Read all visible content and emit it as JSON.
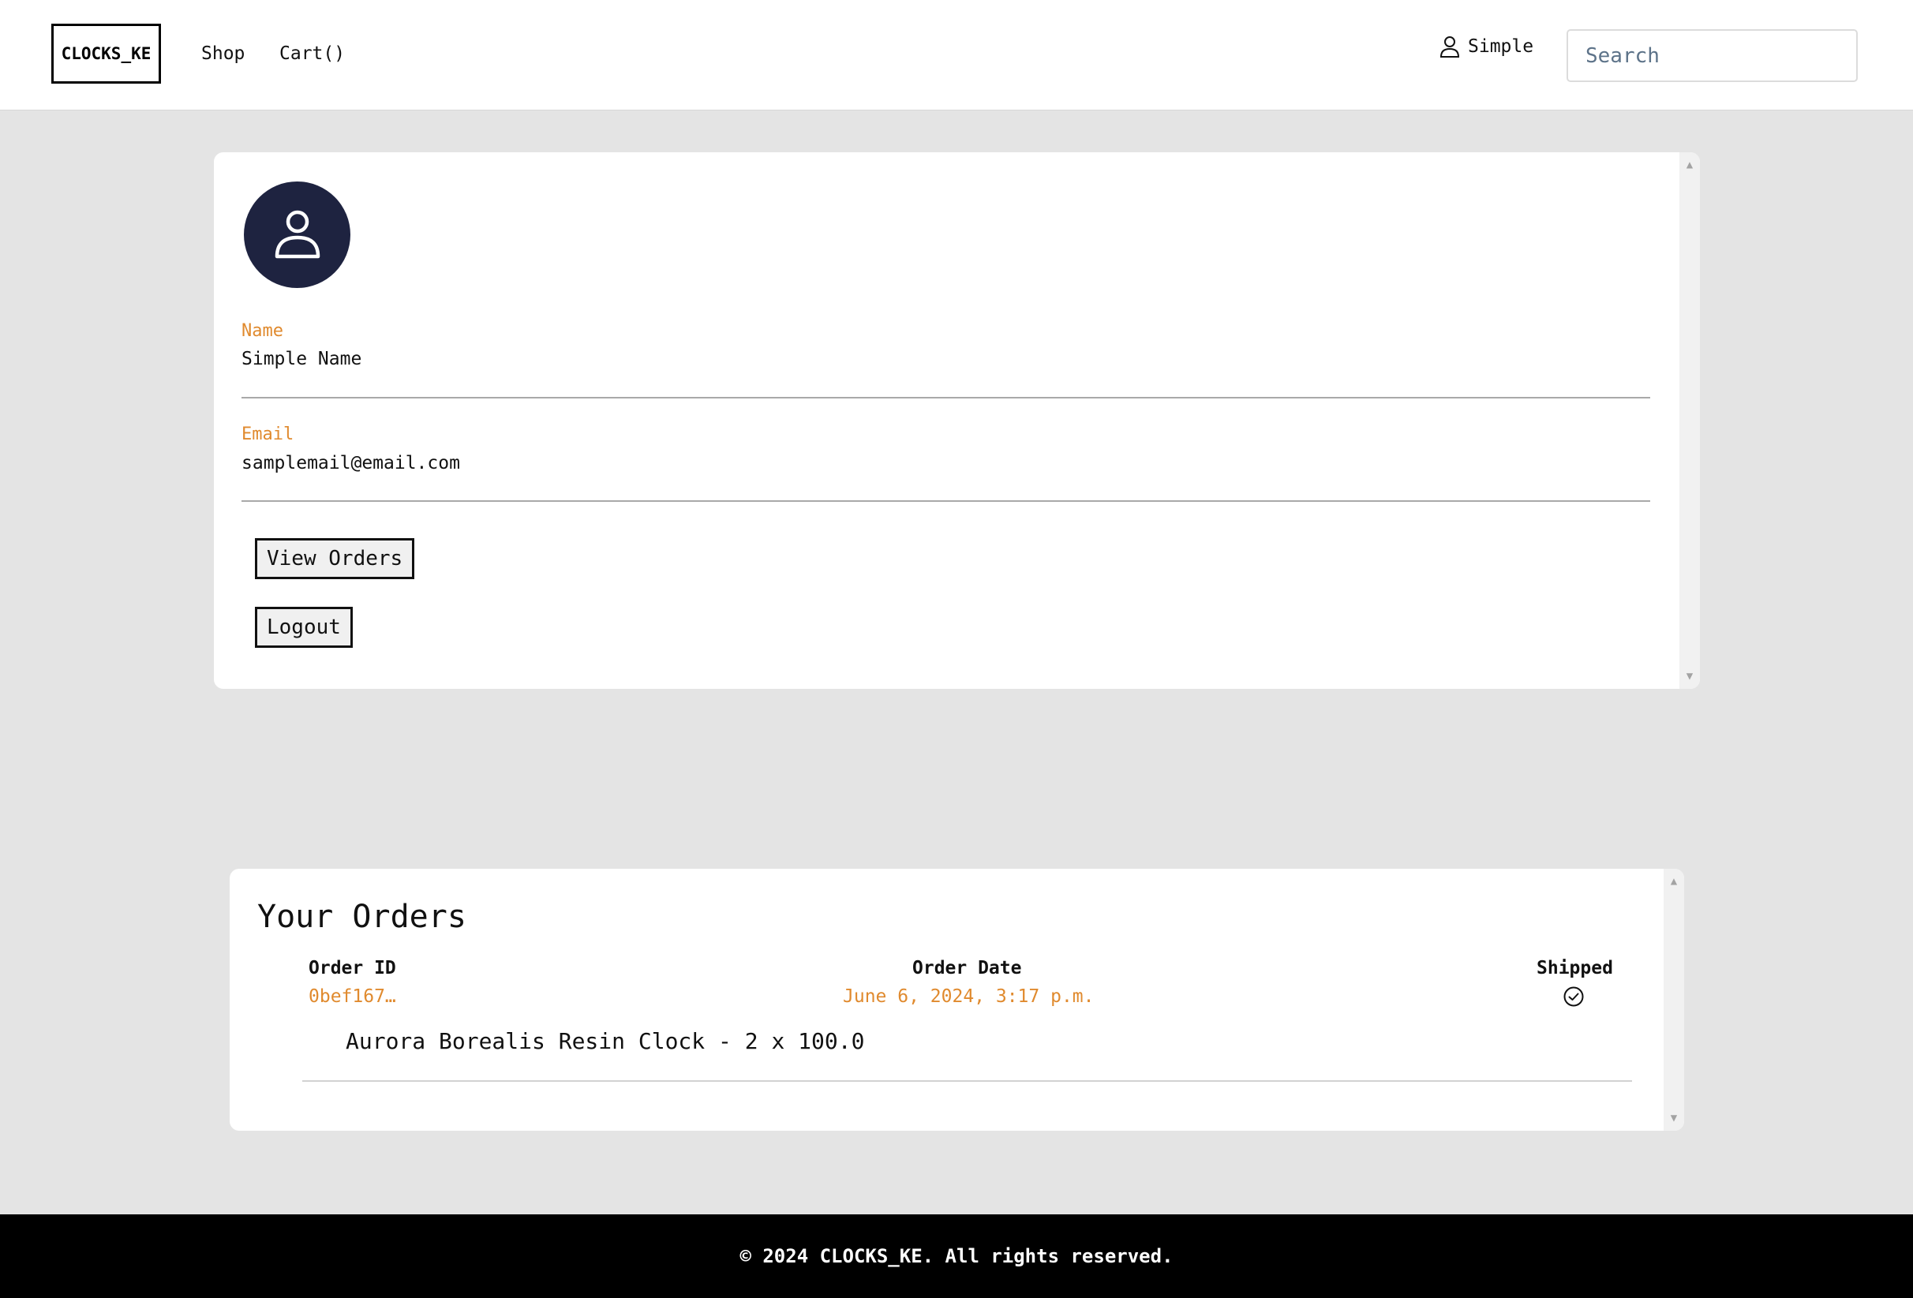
{
  "header": {
    "logo": "CLOCKS_KE",
    "nav": {
      "shop": "Shop",
      "cart": "Cart()"
    },
    "user_label": "Simple",
    "search_placeholder": "Search"
  },
  "profile": {
    "name_label": "Name",
    "name_value": "Simple Name",
    "email_label": "Email",
    "email_value": "samplemail@email.com",
    "view_orders_label": "View Orders",
    "logout_label": "Logout"
  },
  "orders": {
    "title": "Your Orders",
    "columns": {
      "id": "Order ID",
      "date": "Order Date",
      "shipped": "Shipped"
    },
    "rows": [
      {
        "id": "0bef167…",
        "date": "June 6, 2024, 3:17 p.m.",
        "shipped_icon": "check-circle-icon",
        "item": "Aurora Borealis Resin Clock - 2 x 100.0"
      }
    ]
  },
  "footer": {
    "text": "© 2024 CLOCKS_KE. All rights reserved."
  },
  "colors": {
    "accent": "#e08a2e",
    "avatar_bg": "#1e2340",
    "page_bg": "#e4e4e4",
    "footer_bg": "#000000"
  }
}
